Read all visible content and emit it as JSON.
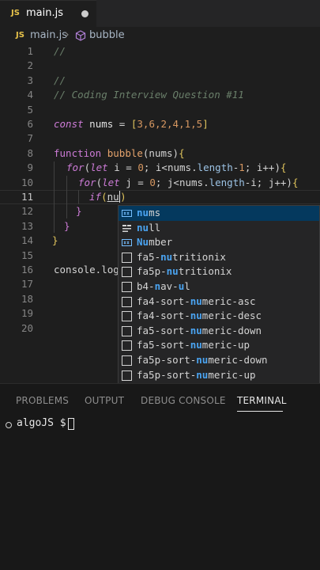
{
  "tab": {
    "icon_text": "JS",
    "file_name": "main.js"
  },
  "breadcrumb": {
    "icon_text": "JS",
    "file": "main.js",
    "symbol": "bubble"
  },
  "line_numbers": [
    "1",
    "2",
    "3",
    "4",
    "5",
    "6",
    "7",
    "8",
    "9",
    "10",
    "11",
    "12",
    "13",
    "14",
    "15",
    "16",
    "17",
    "18",
    "19",
    "20"
  ],
  "code": {
    "l1_comment": "//",
    "l3_comment": "//",
    "l4_comment": "// Coding Interview Question #11",
    "l6_const": "const",
    "l6_var": "nums",
    "l6_eq": " = ",
    "l6_open": "[",
    "l6_values": "3,6,2,4,1,5",
    "l6_close": "]",
    "l8_kw": "function",
    "l8_name": "bubble",
    "l8_params": "(nums)",
    "l8_brace": "{",
    "l9_for": "for",
    "l9_rest_a": "(",
    "l9_let": "let",
    "l9_rest_b": " i = ",
    "l9_zero": "0",
    "l9_rest_c": "; i<nums.",
    "l9_length": "length",
    "l9_rest_d": "-",
    "l9_one": "1",
    "l9_rest_e": "; i++)",
    "l9_brace": "{",
    "l10_for": "for",
    "l10_rest_a": "(",
    "l10_let": "let",
    "l10_rest_b": " j = ",
    "l10_zero": "0",
    "l10_rest_c": "; j<nums.",
    "l10_length": "length",
    "l10_rest_d": "-i; j++)",
    "l10_brace": "{",
    "l11_if": "if",
    "l11_open": "(",
    "l11_typed": "nu",
    "l11_close": ")",
    "l12_brace": "}",
    "l13_brace": "}",
    "l14_brace": "}",
    "l16_console": "console.log"
  },
  "suggestions": [
    {
      "icon": "variable-icon",
      "match": "nu",
      "rest": "ms",
      "selected": true
    },
    {
      "icon": "keyword-icon",
      "match": "nu",
      "rest": "ll",
      "selected": false
    },
    {
      "icon": "variable-icon",
      "match": "Nu",
      "rest": "mber",
      "selected": false
    },
    {
      "icon": "snippet-icon",
      "pre": "fa5-",
      "match": "nu",
      "rest": "tritionix",
      "selected": false
    },
    {
      "icon": "snippet-icon",
      "pre": "fa5p-",
      "match": "nu",
      "rest": "tritionix",
      "selected": false
    },
    {
      "icon": "snippet-icon",
      "pre": "b4-",
      "match": "n",
      "mid": "av-",
      "match2": "u",
      "rest": "l",
      "selected": false
    },
    {
      "icon": "snippet-icon",
      "pre": "fa4-sort-",
      "match": "nu",
      "rest": "meric-asc",
      "selected": false
    },
    {
      "icon": "snippet-icon",
      "pre": "fa4-sort-",
      "match": "nu",
      "rest": "meric-desc",
      "selected": false
    },
    {
      "icon": "snippet-icon",
      "pre": "fa5-sort-",
      "match": "nu",
      "rest": "meric-down",
      "selected": false
    },
    {
      "icon": "snippet-icon",
      "pre": "fa5-sort-",
      "match": "nu",
      "rest": "meric-up",
      "selected": false
    },
    {
      "icon": "snippet-icon",
      "pre": "fa5p-sort-",
      "match": "nu",
      "rest": "meric-down",
      "selected": false
    },
    {
      "icon": "snippet-icon",
      "pre": "fa5p-sort-",
      "match": "nu",
      "rest": "meric-up",
      "selected": false
    }
  ],
  "panel": {
    "tabs": [
      "PROBLEMS",
      "OUTPUT",
      "DEBUG CONSOLE",
      "TERMINAL"
    ],
    "active_tab": "TERMINAL",
    "prompt": "algoJS $"
  },
  "colors": {
    "background": "#1e1e1e",
    "comment": "#6a7f6a",
    "keyword": "#cc7bd6",
    "function": "#e5a36c",
    "number": "#d69761",
    "bracket": "#e0c45c",
    "match_highlight": "#4aa3f0",
    "selection": "#04395e"
  }
}
